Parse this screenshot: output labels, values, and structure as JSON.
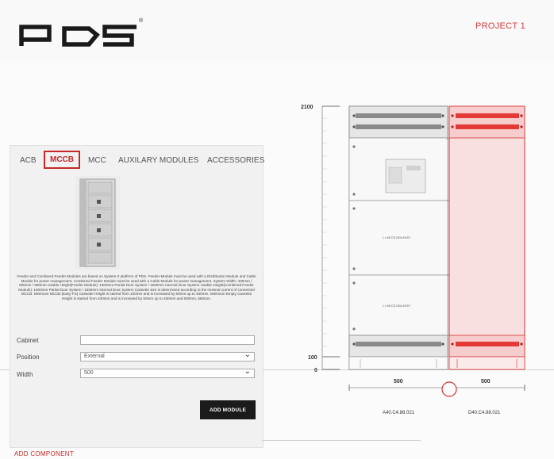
{
  "brand": {
    "logo_text": "PDS"
  },
  "header": {
    "project": "PROJECT 1"
  },
  "tabs": [
    {
      "label": "ACB"
    },
    {
      "label": "MCCB"
    },
    {
      "label": "MCC"
    },
    {
      "label": "AUXILARY MODULES"
    },
    {
      "label": "ACCESSORIES"
    }
  ],
  "product": {
    "description": "Feeder and Combined Feeder Modules are based on System-2 platform of PDS. Feeder Module must be used with a Distribution Module and Cable Module for power management. Combined Feeder Module must be used with a Cable Module for power management. System Width: 400mm / 500mm / 600mm Usable Height(Feeder Module): 1600mm Partial Door System / 1650mm Internal Door System Usable Height(Combined Feeder Module): 1600mm Partial Door System / 1650mm Internal Door System Cassette size is determined according to the nominal current of connected MCCB. Minimum MCCB (Easy-Fix) Cassette Height is started from 100mm and is increased by 50mm up to 450mm. Minimum Empty Cassette Height is started from 100mm and is increased by 50mm up to 450mm and 500mm, 550mm."
  },
  "form": {
    "cabinet_label": "Cabinet",
    "cabinet_value": "",
    "position_label": "Position",
    "position_value": "External",
    "width_label": "Width",
    "width_value": "500",
    "add_module_label": "ADD MODULE"
  },
  "footer": {
    "add_component": "ADD COMPONENT"
  },
  "elevation": {
    "height_top": "2100",
    "height_100": "100",
    "height_0": "0",
    "width_left": "500",
    "width_right": "500",
    "code_left": "A40.C4.88.021",
    "code_right": "D40.C4.88.021",
    "module_label_1": "1 x MCCB 250A EASY",
    "module_label_2": "1 x MCCB 250A EASY"
  },
  "colors": {
    "accent": "#c62828",
    "highlight": "#f9e0e0"
  }
}
